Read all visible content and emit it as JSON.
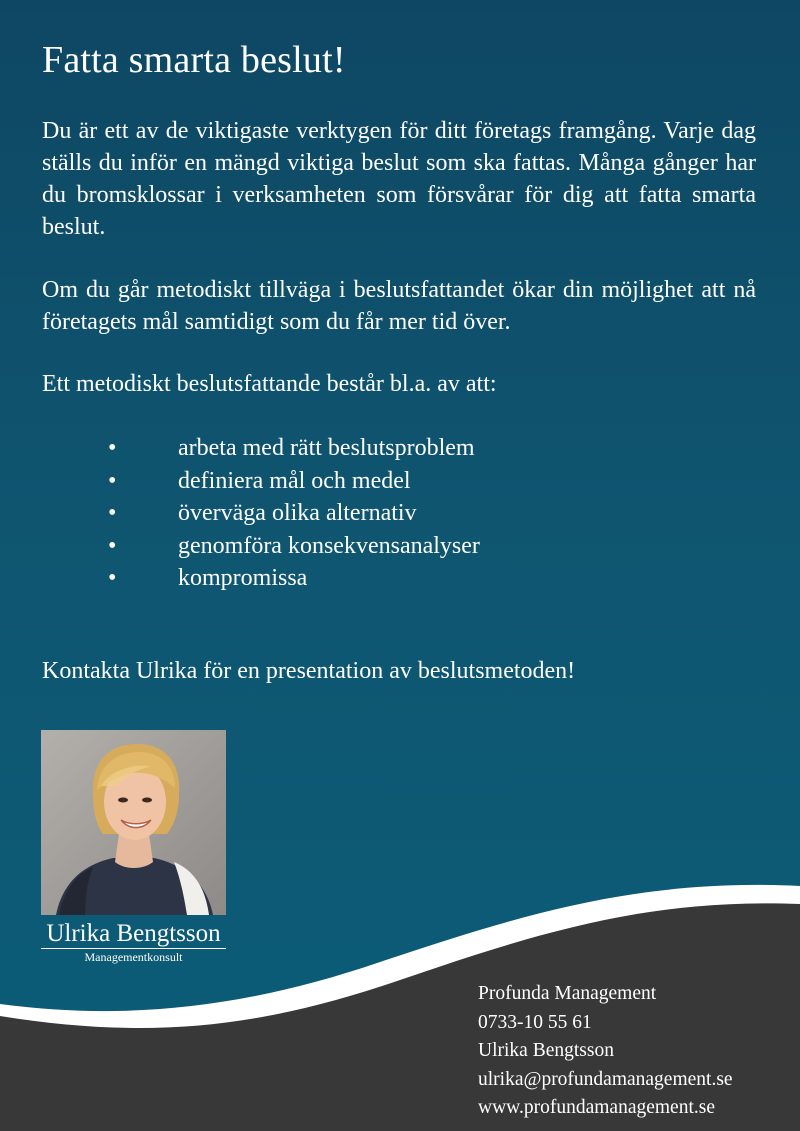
{
  "heading": "Fatta smarta beslut!",
  "paragraphs": {
    "p1": "Du är ett av de viktigaste verktygen för ditt företags framgång. Varje dag ställs du inför en mängd viktiga beslut som ska fattas. Många gånger har du bromsklossar i verksamheten som försvårar för dig att fatta smarta beslut.",
    "p2": "Om du går metodiskt tillväga i beslutsfattandet ökar din möjlighet att nå företagets mål samtidigt som du får mer tid över.",
    "p3": "Ett metodiskt beslutsfattande består bl.a. av att:"
  },
  "bullet_glyph": "•",
  "bullets": [
    "arbeta med rätt beslutsproblem",
    "definiera mål och medel",
    "överväga olika alternativ",
    "genomföra konsekvensanalyser",
    "kompromissa"
  ],
  "cta": "Kontakta Ulrika för en presentation av beslutsmetoden!",
  "person": {
    "name": "Ulrika Bengtsson",
    "title": "Managementkonsult"
  },
  "contact": {
    "company": "Profunda Management",
    "phone": "0733-10 55 61",
    "name": "Ulrika Bengtsson",
    "email": "ulrika@profundamanagement.se",
    "website": "www.profundamanagement.se"
  },
  "colors": {
    "background_top": "#0e4763",
    "background_bottom": "#0b5d78",
    "footer": "#383838",
    "wave": "#ffffff",
    "text": "#ffffff"
  }
}
